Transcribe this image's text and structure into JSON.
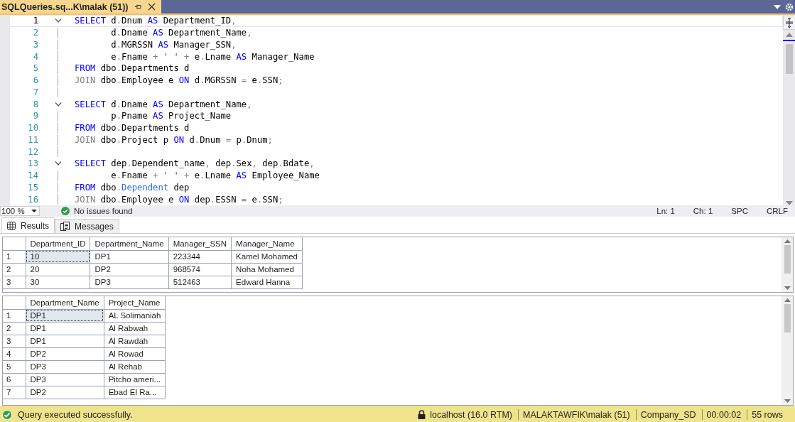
{
  "document_tab": {
    "title": "SQLQueries.sq...K\\malak (51))",
    "selected": true
  },
  "code_lines": [
    {
      "number": "1",
      "fold": true,
      "current": true,
      "tokens": [
        {
          "kind": "kw",
          "t": "SELECT"
        },
        {
          "kind": "id",
          "t": " d"
        },
        {
          "kind": "op",
          "t": "."
        },
        {
          "kind": "id",
          "t": "Dnum "
        },
        {
          "kind": "kw",
          "t": "AS"
        },
        {
          "kind": "id",
          "t": " Department_ID"
        },
        {
          "kind": "op",
          "t": ","
        }
      ]
    },
    {
      "number": "2",
      "fold": false,
      "current": false,
      "tokens": [
        {
          "kind": "id",
          "t": "       d"
        },
        {
          "kind": "op",
          "t": "."
        },
        {
          "kind": "id",
          "t": "Dname "
        },
        {
          "kind": "kw",
          "t": "AS"
        },
        {
          "kind": "id",
          "t": " Department_Name"
        },
        {
          "kind": "op",
          "t": ","
        }
      ]
    },
    {
      "number": "3",
      "fold": false,
      "current": false,
      "tokens": [
        {
          "kind": "id",
          "t": "       d"
        },
        {
          "kind": "op",
          "t": "."
        },
        {
          "kind": "id",
          "t": "MGRSSN "
        },
        {
          "kind": "kw",
          "t": "AS"
        },
        {
          "kind": "id",
          "t": " Manager_SSN"
        },
        {
          "kind": "op",
          "t": ","
        }
      ]
    },
    {
      "number": "4",
      "fold": false,
      "current": false,
      "tokens": [
        {
          "kind": "id",
          "t": "       e"
        },
        {
          "kind": "op",
          "t": "."
        },
        {
          "kind": "id",
          "t": "Fname "
        },
        {
          "kind": "op",
          "t": "+ "
        },
        {
          "kind": "str",
          "t": "' '"
        },
        {
          "kind": "op",
          "t": " + "
        },
        {
          "kind": "id",
          "t": "e"
        },
        {
          "kind": "op",
          "t": "."
        },
        {
          "kind": "id",
          "t": "Lname "
        },
        {
          "kind": "kw",
          "t": "AS"
        },
        {
          "kind": "id",
          "t": " Manager_Name"
        }
      ]
    },
    {
      "number": "5",
      "fold": false,
      "current": false,
      "tokens": [
        {
          "kind": "kw",
          "t": "FROM"
        },
        {
          "kind": "id",
          "t": " dbo"
        },
        {
          "kind": "op",
          "t": "."
        },
        {
          "kind": "id",
          "t": "Departments d"
        }
      ]
    },
    {
      "number": "6",
      "fold": false,
      "current": false,
      "tokens": [
        {
          "kind": "op",
          "t": "JOIN"
        },
        {
          "kind": "id",
          "t": " dbo"
        },
        {
          "kind": "op",
          "t": "."
        },
        {
          "kind": "id",
          "t": "Employee e "
        },
        {
          "kind": "kw",
          "t": "ON"
        },
        {
          "kind": "id",
          "t": " d"
        },
        {
          "kind": "op",
          "t": "."
        },
        {
          "kind": "id",
          "t": "MGRSSN "
        },
        {
          "kind": "op",
          "t": "="
        },
        {
          "kind": "id",
          "t": " e"
        },
        {
          "kind": "op",
          "t": "."
        },
        {
          "kind": "id",
          "t": "SSN"
        },
        {
          "kind": "op",
          "t": ";"
        }
      ]
    },
    {
      "number": "7",
      "fold": false,
      "current": false
    },
    {
      "number": "8",
      "fold": true,
      "current": false,
      "tokens": [
        {
          "kind": "kw",
          "t": "SELECT"
        },
        {
          "kind": "id",
          "t": " d"
        },
        {
          "kind": "op",
          "t": "."
        },
        {
          "kind": "id",
          "t": "Dname "
        },
        {
          "kind": "kw",
          "t": "AS"
        },
        {
          "kind": "id",
          "t": " Department_Name"
        },
        {
          "kind": "op",
          "t": ","
        }
      ]
    },
    {
      "number": "9",
      "fold": false,
      "current": false,
      "tokens": [
        {
          "kind": "id",
          "t": "       p"
        },
        {
          "kind": "op",
          "t": "."
        },
        {
          "kind": "id",
          "t": "Pname "
        },
        {
          "kind": "kw",
          "t": "AS"
        },
        {
          "kind": "id",
          "t": " Project_Name"
        }
      ]
    },
    {
      "number": "10",
      "fold": false,
      "current": false,
      "tokens": [
        {
          "kind": "kw",
          "t": "FROM"
        },
        {
          "kind": "id",
          "t": " dbo"
        },
        {
          "kind": "op",
          "t": "."
        },
        {
          "kind": "id",
          "t": "Departments d"
        }
      ]
    },
    {
      "number": "11",
      "fold": false,
      "current": false,
      "tokens": [
        {
          "kind": "op",
          "t": "JOIN"
        },
        {
          "kind": "id",
          "t": " dbo"
        },
        {
          "kind": "op",
          "t": "."
        },
        {
          "kind": "id",
          "t": "Project p "
        },
        {
          "kind": "kw",
          "t": "ON"
        },
        {
          "kind": "id",
          "t": " d"
        },
        {
          "kind": "op",
          "t": "."
        },
        {
          "kind": "id",
          "t": "Dnum "
        },
        {
          "kind": "op",
          "t": "="
        },
        {
          "kind": "id",
          "t": " p"
        },
        {
          "kind": "op",
          "t": "."
        },
        {
          "kind": "id",
          "t": "Dnum"
        },
        {
          "kind": "op",
          "t": ";"
        }
      ]
    },
    {
      "number": "12",
      "fold": false,
      "current": false
    },
    {
      "number": "13",
      "fold": true,
      "current": false,
      "tokens": [
        {
          "kind": "kw",
          "t": "SELECT"
        },
        {
          "kind": "id",
          "t": " dep"
        },
        {
          "kind": "op",
          "t": "."
        },
        {
          "kind": "id",
          "t": "Dependent_name"
        },
        {
          "kind": "op",
          "t": ", "
        },
        {
          "kind": "id",
          "t": "dep"
        },
        {
          "kind": "op",
          "t": "."
        },
        {
          "kind": "id",
          "t": "Sex"
        },
        {
          "kind": "op",
          "t": ", "
        },
        {
          "kind": "id",
          "t": "dep"
        },
        {
          "kind": "op",
          "t": "."
        },
        {
          "kind": "id",
          "t": "Bdate"
        },
        {
          "kind": "op",
          "t": ","
        }
      ]
    },
    {
      "number": "14",
      "fold": false,
      "current": false,
      "tokens": [
        {
          "kind": "id",
          "t": "       e"
        },
        {
          "kind": "op",
          "t": "."
        },
        {
          "kind": "id",
          "t": "Fname "
        },
        {
          "kind": "op",
          "t": "+ "
        },
        {
          "kind": "str",
          "t": "' '"
        },
        {
          "kind": "op",
          "t": " + "
        },
        {
          "kind": "id",
          "t": "e"
        },
        {
          "kind": "op",
          "t": "."
        },
        {
          "kind": "id",
          "t": "Lname "
        },
        {
          "kind": "kw",
          "t": "AS"
        },
        {
          "kind": "id",
          "t": " Employee_Name"
        }
      ]
    },
    {
      "number": "15",
      "fold": false,
      "current": false,
      "tokens": [
        {
          "kind": "kw",
          "t": "FROM"
        },
        {
          "kind": "id",
          "t": " dbo"
        },
        {
          "kind": "op",
          "t": "."
        },
        {
          "kind": "type",
          "t": "Dependent"
        },
        {
          "kind": "id",
          "t": " dep"
        }
      ]
    },
    {
      "number": "16",
      "fold": false,
      "current": false,
      "tokens": [
        {
          "kind": "op",
          "t": "JOIN"
        },
        {
          "kind": "id",
          "t": " dbo"
        },
        {
          "kind": "op",
          "t": "."
        },
        {
          "kind": "id",
          "t": "Employee e "
        },
        {
          "kind": "kw",
          "t": "ON"
        },
        {
          "kind": "id",
          "t": " dep"
        },
        {
          "kind": "op",
          "t": "."
        },
        {
          "kind": "id",
          "t": "ESSN "
        },
        {
          "kind": "op",
          "t": "="
        },
        {
          "kind": "id",
          "t": " e"
        },
        {
          "kind": "op",
          "t": "."
        },
        {
          "kind": "id",
          "t": "SSN"
        },
        {
          "kind": "op",
          "t": ";"
        }
      ]
    }
  ],
  "editor_status": {
    "zoom": "100 %",
    "issues": "No issues found",
    "line": "Ln: 1",
    "char": "Ch: 1",
    "indent": "SPC",
    "line_ending": "CRLF"
  },
  "result_tabs": [
    {
      "label": "Results",
      "selected": true,
      "kind": "grid"
    },
    {
      "label": "Messages",
      "selected": false,
      "kind": "messages"
    }
  ],
  "result_grids": [
    {
      "columns": [
        "Department_ID",
        "Department_Name",
        "Manager_SSN",
        "Manager_Name"
      ],
      "rows": [
        {
          "number": "1",
          "selected": true,
          "cells": [
            "10",
            "DP1",
            "223344",
            "Kamel Mohamed"
          ]
        },
        {
          "number": "2",
          "selected": false,
          "cells": [
            "20",
            "DP2",
            "968574",
            "Noha Mohamed"
          ]
        },
        {
          "number": "3",
          "selected": false,
          "cells": [
            "30",
            "DP3",
            "512463",
            "Edward Hanna"
          ]
        }
      ]
    },
    {
      "columns": [
        "Department_Name",
        "Project_Name"
      ],
      "rows": [
        {
          "number": "1",
          "selected": true,
          "cells": [
            "DP1",
            "AL Solimaniah"
          ]
        },
        {
          "number": "2",
          "selected": false,
          "cells": [
            "DP1",
            "Al Rabwah"
          ]
        },
        {
          "number": "3",
          "selected": false,
          "cells": [
            "DP1",
            "Al Rawdah"
          ]
        },
        {
          "number": "4",
          "selected": false,
          "cells": [
            "DP2",
            "Al Rowad"
          ]
        },
        {
          "number": "5",
          "selected": false,
          "cells": [
            "DP3",
            "Al Rehab"
          ]
        },
        {
          "number": "6",
          "selected": false,
          "cells": [
            "DP3",
            "Pitcho ameri..."
          ]
        },
        {
          "number": "7",
          "selected": false,
          "cells": [
            "DP2",
            "Ebad El Ra..."
          ]
        }
      ]
    }
  ],
  "status_bar": {
    "message": "Query executed successfully.",
    "server": "localhost (16.0 RTM)",
    "user": "MALAKTAWFIK\\malak (51)",
    "database": "Company_SD",
    "elapsed": "00:00:02",
    "rows": "55 rows"
  }
}
